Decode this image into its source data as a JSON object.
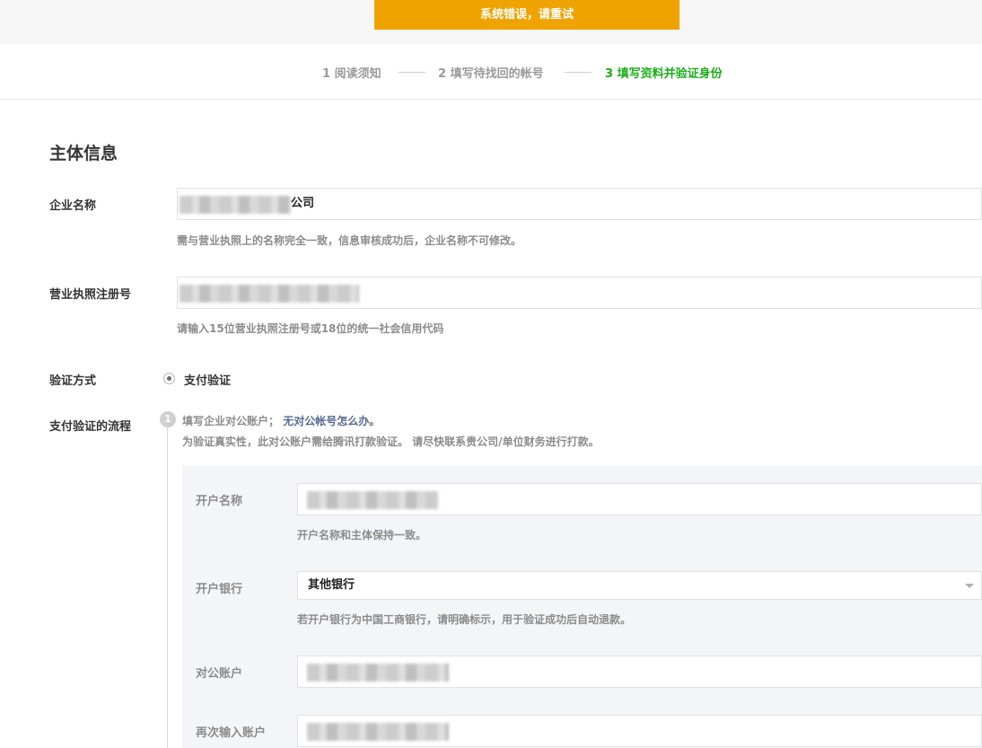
{
  "toast": {
    "message": "系统错误，请重试"
  },
  "steps": [
    {
      "label": "1 阅读须知"
    },
    {
      "label": "2 填写待找回的帐号"
    },
    {
      "label": "3 填写资料并验证身份"
    }
  ],
  "main": {
    "section_title": "主体信息",
    "company_name": {
      "label": "企业名称",
      "value_suffix": "公司",
      "hint": "需与营业执照上的名称完全一致，信息审核成功后，企业名称不可修改。"
    },
    "license_no": {
      "label": "营业执照注册号",
      "hint": "请输入15位营业执照注册号或18位的统一社会信用代码"
    },
    "verify_method": {
      "label": "验证方式",
      "option": "支付验证"
    },
    "flow": {
      "label": "支付验证的流程",
      "step_num": "1",
      "step_text": "填写企业对公账户；",
      "step_link": "无对公帐号怎么办。",
      "step_desc": "为验证真实性，此对公账户需给腾讯打款验证。 请尽快联系贵公司/单位财务进行打款。"
    },
    "panel": {
      "account_name": {
        "label": "开户名称",
        "hint": "开户名称和主体保持一致。"
      },
      "bank": {
        "label": "开户银行",
        "selected": "其他银行",
        "hint": "若开户银行为中国工商银行，请明确标示，用于验证成功后自动退款。"
      },
      "account_no": {
        "label": "对公账户"
      },
      "account_no_confirm": {
        "label": "再次输入账户"
      }
    }
  }
}
